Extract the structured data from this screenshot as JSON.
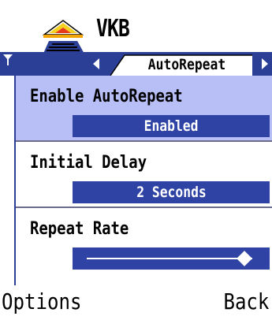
{
  "app": {
    "title": "VKB"
  },
  "tabbar": {
    "active_tab": "AutoRepeat"
  },
  "settings": {
    "items": [
      {
        "label": "Enable AutoRepeat",
        "value": "Enabled"
      },
      {
        "label": "Initial Delay",
        "value": "2 Seconds"
      },
      {
        "label": "Repeat Rate",
        "slider_level": 0.95
      }
    ]
  },
  "softkeys": {
    "left": "Options",
    "right": "Back"
  },
  "colors": {
    "accent": "#2c3f96",
    "selection": "#b7bff6",
    "value_bg": "#2f43a5"
  },
  "icons": [
    "vkb-app-icon",
    "signal-icon",
    "tab-left-arrow-icon",
    "tab-right-arrow-icon"
  ]
}
